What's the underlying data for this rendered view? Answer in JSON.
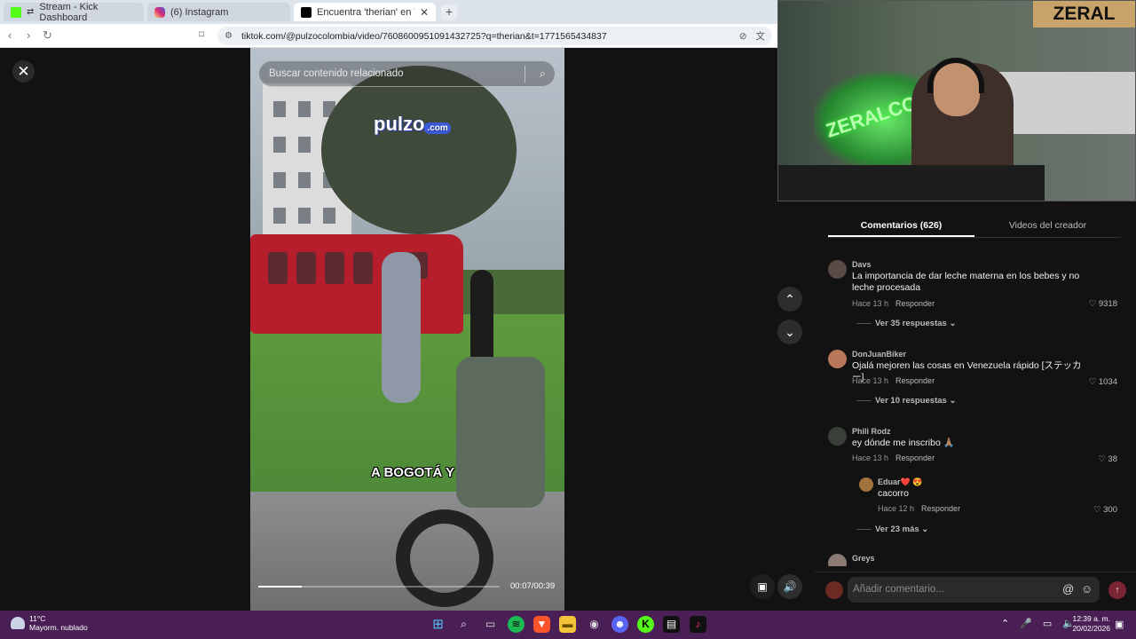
{
  "browser": {
    "tabs": [
      {
        "label": "Stream - Kick Dashboard",
        "favicon": "K",
        "color": "#53fc18"
      },
      {
        "label": "(6) Instagram",
        "favicon": "instagram-icon",
        "color": "#d62976"
      },
      {
        "label": "Encuentra 'therian' en TikTok",
        "favicon": "tiktok-icon",
        "color": "#000000"
      }
    ],
    "add_tab": "+",
    "url": "tiktok.com/@pulzocolombia/video/7608600951091432725?q=therian&t=1771565434837"
  },
  "video": {
    "search_placeholder": "Buscar contenido relacionado",
    "logo_main": "pulzo",
    "logo_suffix": ".com",
    "caption": "A BOGOTÁ Y",
    "time": "00:07/00:39",
    "progress": 0.18
  },
  "comments_panel": {
    "tabs": [
      "Comentarios (626)",
      "Videos del creador"
    ],
    "comments": [
      {
        "user": "Davs",
        "text": "La importancia de dar leche materna en los bebes y no leche procesada",
        "time": "Hace 13 h",
        "reply": "Responder",
        "likes": "9318",
        "more": "Ver 35 respuestas",
        "avatar": "#5a4a46"
      },
      {
        "user": "DonJuanBiker",
        "text": "Ojalá mejoren las cosas en Venezuela rápido [ステッカー]",
        "time": "Hace 13 h",
        "reply": "Responder",
        "likes": "1034",
        "more": "Ver 10 respuestas",
        "avatar": "#b9785a"
      },
      {
        "user": "Phili Rodz",
        "text": "ey dónde me inscribo 🙏🏽",
        "time": "Hace 13 h",
        "reply": "Responder",
        "likes": "38",
        "avatar": "#3a3f3a"
      }
    ],
    "nested_reply": {
      "user": "Eduar❤️ 😍",
      "text": "cacorro",
      "time": "Hace 12 h",
      "reply": "Responder",
      "likes": "300"
    },
    "more_nested": "Ver 23 más",
    "last_user": "Greys",
    "composer_placeholder": "Añadir comentario..."
  },
  "webcam": {
    "brand": "ZERAL",
    "neon": "ZERALCO"
  },
  "taskbar": {
    "temperature": "11°C",
    "weather": "Mayorm. nublado",
    "time": "12:39 a. m.",
    "date": "20/02/2026"
  }
}
